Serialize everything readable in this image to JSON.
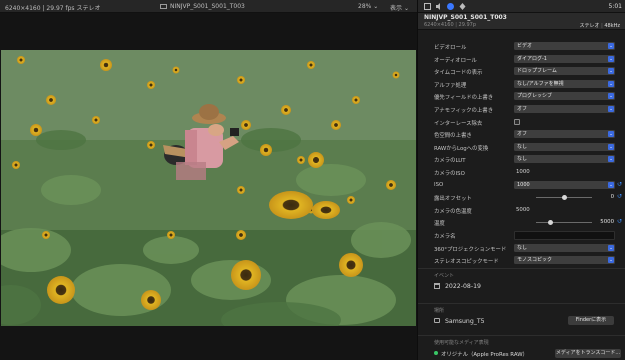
{
  "viewer": {
    "clip_info": "6240×4160 | 29.97 fps ステレオ",
    "clip_name": "NINJVP_S001_S001_T003",
    "zoom": "28%",
    "view_menu": "表示"
  },
  "inspector": {
    "duration": "5:01",
    "clip_name": "NINJVP_S001_S001_T003",
    "resolution": "6240×4160",
    "framerate": "29.97p",
    "audio": "ステレオ",
    "samplerate": "48kHz",
    "properties": [
      {
        "label": "ビデオロール",
        "kind": "select",
        "value": "ビデオ"
      },
      {
        "label": "オーディオロール",
        "kind": "select",
        "value": "ダイアログ-1"
      },
      {
        "label": "タイムコードの表示",
        "kind": "select",
        "value": "ドロップフレーム"
      },
      {
        "label": "アルファ処理",
        "kind": "select",
        "value": "なし/アルファを無視"
      },
      {
        "label": "優先フィールドの上書き",
        "kind": "select",
        "value": "プログレッシブ"
      },
      {
        "label": "アナモフィックの上書き",
        "kind": "select",
        "value": "オフ"
      },
      {
        "label": "インターレース除去",
        "kind": "checkbox",
        "value": ""
      },
      {
        "label": "色空間の上書き",
        "kind": "select",
        "value": "オフ"
      },
      {
        "label": "RAWからLogへの変換",
        "kind": "select",
        "value": "なし"
      },
      {
        "label": "カメラのLUT",
        "kind": "select",
        "value": "なし"
      },
      {
        "label": "カメラのISO",
        "kind": "text",
        "value": "1000"
      },
      {
        "label": "ISO",
        "kind": "select",
        "value": "1000"
      },
      {
        "label": "露出オフセット",
        "kind": "slider",
        "value": "0",
        "level": 0.5
      },
      {
        "label": "カメラの色温度",
        "kind": "text",
        "value": "5000"
      },
      {
        "label": "温度",
        "kind": "slider",
        "value": "5000",
        "level": 0.25
      },
      {
        "label": "カメラ名",
        "kind": "input",
        "value": ""
      },
      {
        "label": "360°プロジェクションモード",
        "kind": "select",
        "value": "なし"
      },
      {
        "label": "ステレオスコピックモード",
        "kind": "select",
        "value": "モノスコピック"
      }
    ],
    "event": {
      "header": "イベント",
      "date": "2022-08-19"
    },
    "location": {
      "header": "場所",
      "name": "Samsung_T5",
      "reveal_button": "Finderに表示"
    },
    "media": {
      "header": "使用可能なメディア表現",
      "original": "オリジナル（Apple ProRes RAW）",
      "transcode_button": "メディアをトランスコード..."
    }
  }
}
